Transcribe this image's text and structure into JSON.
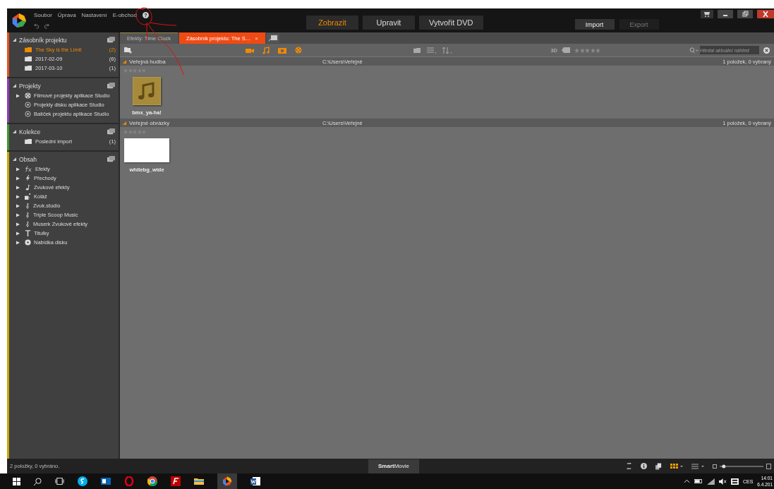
{
  "menu": [
    "Soubor",
    "Úprava",
    "Nastavení",
    "E-obchod"
  ],
  "help": "?",
  "mode_tabs": [
    {
      "label": "Zobrazit",
      "selected": true
    },
    {
      "label": "Upravit",
      "selected": false
    },
    {
      "label": "Vytvořit DVD",
      "selected": false
    }
  ],
  "transfer_buttons": [
    {
      "label": "Import",
      "disabled": false
    },
    {
      "label": "Export",
      "disabled": true
    }
  ],
  "sidebar": [
    {
      "title": "Zásobník projektu",
      "color": "#e8501e",
      "items": [
        {
          "label": "The Sky is the Limit",
          "count": "(2)",
          "kind": "folder",
          "selected": true,
          "expandable": false
        },
        {
          "label": "2017-02-09",
          "count": "(6)",
          "kind": "folder",
          "selected": false,
          "expandable": false
        },
        {
          "label": "2017-03-10",
          "count": "(1)",
          "kind": "folder",
          "selected": false,
          "expandable": false
        }
      ]
    },
    {
      "title": "Projekty",
      "color": "#8e3ab8",
      "items": [
        {
          "label": "Filmové projekty aplikace Studio",
          "kind": "film",
          "selected": false,
          "expandable": true
        },
        {
          "label": "Projekty disku aplikace Studio",
          "kind": "disc",
          "selected": false,
          "expandable": false
        },
        {
          "label": "Balíček projektu aplikace Studio",
          "kind": "disc",
          "selected": false,
          "expandable": false
        }
      ]
    },
    {
      "title": "Kolekce",
      "color": "#3c9a2c",
      "items": [
        {
          "label": "Poslední import",
          "count": "(1)",
          "kind": "folder",
          "selected": false,
          "expandable": false
        }
      ]
    },
    {
      "title": "Obsah",
      "color": "#c8a400",
      "items": [
        {
          "label": "Efekty",
          "kind": "fx",
          "selected": false,
          "expandable": true
        },
        {
          "label": "Přechody",
          "kind": "bolt",
          "selected": false,
          "expandable": true
        },
        {
          "label": "Zvukové efekty",
          "kind": "note",
          "selected": false,
          "expandable": true
        },
        {
          "label": "Koláž",
          "kind": "collage",
          "selected": false,
          "expandable": true
        },
        {
          "label": "Zvuk.studio",
          "kind": "clef",
          "selected": false,
          "expandable": true
        },
        {
          "label": "Triple Scoop Music",
          "kind": "clef",
          "selected": false,
          "expandable": true
        },
        {
          "label": "Muserk Zvukové efekty",
          "kind": "clef",
          "selected": false,
          "expandable": true
        },
        {
          "label": "Titulky",
          "kind": "title",
          "selected": false,
          "expandable": true
        },
        {
          "label": "Nabídka disku",
          "kind": "discmenu",
          "selected": false,
          "expandable": true
        }
      ]
    }
  ],
  "doc_tabs": [
    {
      "label": "Efekty: Time Clock",
      "selected": false
    },
    {
      "label": "Zásobník projektu: The S…",
      "selected": true,
      "close": "×"
    }
  ],
  "toolbar": {
    "three_d": "3D",
    "stars": 0,
    "search": {
      "placeholder": "Hledat aktuální náhled"
    }
  },
  "groups": [
    {
      "title": "Veřejná hudba",
      "path": "C:\\Users\\Veřejné",
      "summary": "1 položek, 0 vybraný",
      "stars": 0,
      "items": [
        {
          "name": "bmx_ya-ha!",
          "kind": "audio"
        }
      ]
    },
    {
      "title": "Veřejné obrázky",
      "path": "C:\\Users\\Veřejné",
      "summary": "1 položek, 0 vybraný",
      "stars": 0,
      "items": [
        {
          "name": "whitebg_wide",
          "kind": "image"
        }
      ]
    }
  ],
  "status_bar": {
    "text": "2 položky, 0 vybráno.",
    "smartmovie": "**Smart**Movie",
    "zoom": {
      "level": 0.05
    }
  },
  "taskbar": {
    "language": "CES",
    "time": "14:01",
    "date": "6.4.201"
  }
}
